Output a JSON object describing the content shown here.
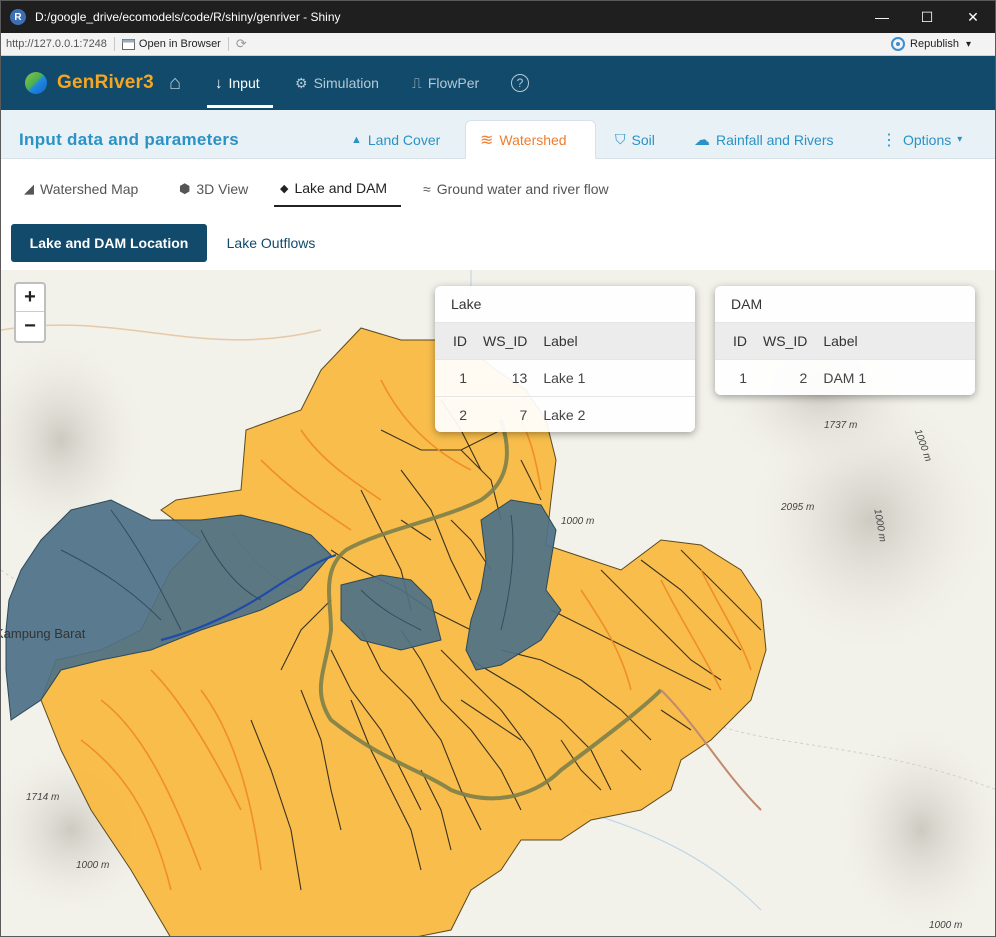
{
  "window": {
    "title": "D:/google_drive/ecomodels/code/R/shiny/genriver - Shiny",
    "minimize_glyph": "—",
    "maximize_glyph": "☐",
    "close_glyph": "✕",
    "app_icon_glyph": "R"
  },
  "addressbar": {
    "url": "http://127.0.0.1:7248",
    "open_in_browser": "Open in Browser",
    "republish": "Republish",
    "refresh_glyph": "⟳",
    "dropdown_glyph": "▾"
  },
  "navbar": {
    "brand_part1": "Gen",
    "brand_part2": "River3",
    "home_glyph": "⌂",
    "items": [
      {
        "label": "Input",
        "icon": "arrow-down-icon",
        "glyph": "↓"
      },
      {
        "label": "Simulation",
        "icon": "gears-icon",
        "glyph": "⚙"
      },
      {
        "label": "FlowPer",
        "icon": "wave-square-icon",
        "glyph": "⎍"
      }
    ],
    "help_glyph": "?"
  },
  "card": {
    "title": "Input data and parameters",
    "tabs": [
      {
        "label": "Land Cover",
        "icon": "tree-icon",
        "glyph": "▲"
      },
      {
        "label": "Watershed",
        "icon": "water-icon",
        "glyph": "≋"
      },
      {
        "label": "Soil",
        "icon": "soil-icon",
        "glyph": "⛉"
      },
      {
        "label": "Rainfall and Rivers",
        "icon": "cloud-icon",
        "glyph": "☁"
      },
      {
        "label": "Options",
        "icon": "vertical-dots-icon",
        "glyph": "⋮",
        "caret": "▾"
      }
    ]
  },
  "subtabs": [
    {
      "label": "Watershed Map",
      "icon": "mountain-icon",
      "glyph": "◢"
    },
    {
      "label": "3D View",
      "icon": "cube-icon",
      "glyph": "⬢"
    },
    {
      "label": "Lake and DAM",
      "icon": "fish-icon",
      "glyph": "◆"
    },
    {
      "label": "Ground water and river flow",
      "icon": "water-ladder-icon",
      "glyph": "≈"
    }
  ],
  "pills": {
    "location": "Lake and DAM Location",
    "outflows": "Lake Outflows"
  },
  "map": {
    "zoom_in": "+",
    "zoom_out": "−",
    "place": "Kampung Barat",
    "elevations": [
      "1737 m",
      "1000 m",
      "2095 m",
      "1000 m",
      "1000 m",
      "1714 m",
      "1000 m",
      "1000 m"
    ],
    "colors": {
      "watershed": "#f8b73a",
      "lake": "#4d7187",
      "river": "#f08a24",
      "boundary": "#1a1a1a",
      "mainriver": "#7d7f4a"
    }
  },
  "lake_table": {
    "title": "Lake",
    "headers": [
      "ID",
      "WS_ID",
      "Label"
    ],
    "rows": [
      [
        "1",
        "13",
        "Lake 1"
      ],
      [
        "2",
        "7",
        "Lake 2"
      ]
    ]
  },
  "dam_table": {
    "title": "DAM",
    "headers": [
      "ID",
      "WS_ID",
      "Label"
    ],
    "rows": [
      [
        "1",
        "2",
        "DAM 1"
      ]
    ]
  }
}
